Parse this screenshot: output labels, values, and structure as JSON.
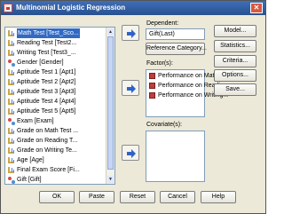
{
  "window": {
    "title": "Multinomial Logistic Regression",
    "close_glyph": "✕"
  },
  "variables": [
    {
      "label": "Math Test [Test_Sco...",
      "type": "scale",
      "selected": true
    },
    {
      "label": "Reading Test [Test2...",
      "type": "scale"
    },
    {
      "label": "Writing Test [Test3_...",
      "type": "scale"
    },
    {
      "label": "Gender [Gender]",
      "type": "nominal"
    },
    {
      "label": "Aptitude Test 1 [Apt1]",
      "type": "scale"
    },
    {
      "label": "Aptitude Test 2 [Apt2]",
      "type": "scale"
    },
    {
      "label": "Aptitude Test 3 [Apt3]",
      "type": "scale"
    },
    {
      "label": "Aptitude Test 4 [Apt4]",
      "type": "scale"
    },
    {
      "label": "Aptitude Test 5 [Apt5]",
      "type": "scale"
    },
    {
      "label": "Exam [Exam]",
      "type": "nominal"
    },
    {
      "label": "Grade on Math Test ...",
      "type": "scale"
    },
    {
      "label": "Grade on Reading T...",
      "type": "scale"
    },
    {
      "label": "Grade on Writing Te...",
      "type": "scale"
    },
    {
      "label": "Age [Age]",
      "type": "scale"
    },
    {
      "label": "Final Exam Score [Fi...",
      "type": "scale"
    },
    {
      "label": "Gift [Gift]",
      "type": "nominal"
    }
  ],
  "dependent": {
    "label": "Dependent:",
    "value": "Gift(Last)",
    "reference_button": "Reference Category..."
  },
  "factors": {
    "label": "Factor(s):",
    "items": [
      "Performance on Math T...",
      "Performance on Readin...",
      "Performance on Writing..."
    ]
  },
  "covariates": {
    "label": "Covariate(s):"
  },
  "side_buttons": {
    "model": "Model...",
    "statistics": "Statistics...",
    "criteria": "Criteria...",
    "options": "Options...",
    "save": "Save..."
  },
  "bottom_buttons": {
    "ok": "OK",
    "paste": "Paste",
    "reset": "Reset",
    "cancel": "Cancel",
    "help": "Help"
  },
  "colors": {
    "title_bar": "#2f5ea8",
    "selection": "#316ac5",
    "arrow": "#2f63c7",
    "factor_icon": "#c23b3b"
  }
}
